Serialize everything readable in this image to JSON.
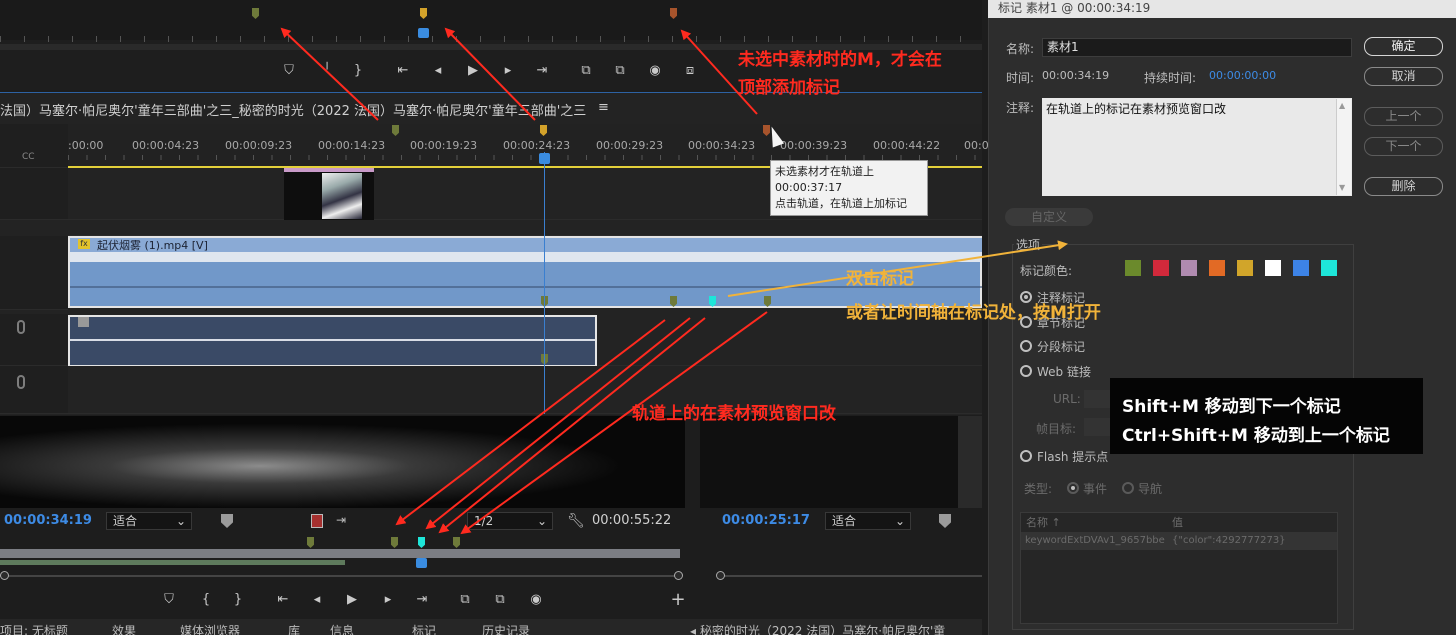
{
  "top_monitor": {
    "transport": [
      "⛉",
      "╵",
      "}",
      "⇤",
      "◂",
      "▶",
      "▸",
      "⇥",
      "⧉",
      "⧉",
      "◉",
      "⧈"
    ]
  },
  "timeline": {
    "sequence_title": "法国）马塞尔·帕尼奥尔'童年三部曲'之三_秘密的时光（2022 法国）马塞尔·帕尼奥尔'童年三部曲'之三",
    "menu_glyph": "≡",
    "cc_label": "CC",
    "ruler_labels": [
      ":00:00",
      "00:00:04:23",
      "00:00:09:23",
      "00:00:14:23",
      "00:00:19:23",
      "00:00:24:23",
      "00:00:29:23",
      "00:00:34:23",
      "00:00:39:23",
      "00:00:44:22",
      "00:0"
    ],
    "clip_v1_name": "起伏烟雾 (1).mp4 [V]",
    "fx": "fx",
    "tooltip": {
      "line1": "未选素材才在轨道上",
      "line2": "00:00:37:17",
      "line3": "点击轨道，在轨道上加标记"
    }
  },
  "source_monitor": {
    "timecode": "00:00:34:19",
    "fit": "适合",
    "resolution": "1/2",
    "duration": "00:00:55:22",
    "transport": [
      "⛉",
      "{",
      "}",
      "⇤",
      "◂",
      "▶",
      "▸",
      "⇥",
      "⧉",
      "⧉",
      "◉"
    ],
    "add": "+"
  },
  "program_monitor": {
    "timecode": "00:00:25:17",
    "fit": "适合"
  },
  "bottom_tabs": [
    "项目: 无标题",
    "效果",
    "媒体浏览器",
    "库",
    "信息",
    "标记",
    "历史记录"
  ],
  "bottom_extra": "◂ 秘密的时光（2022 法国）马塞尔·帕尼奥尔'童",
  "dialog": {
    "title": "标记 素材1 @ 00:00:34:19",
    "name_label": "名称:",
    "name_value": "素材1",
    "time_label": "时间:",
    "time_value": "00:00:34:19",
    "duration_label": "持续时间:",
    "duration_value": "00:00:00:00",
    "notes_label": "注释:",
    "notes_value": "在轨道上的标记在素材预览窗口改",
    "buttons": {
      "ok": "确定",
      "cancel": "取消",
      "prev": "上一个",
      "next": "下一个",
      "delete": "删除"
    },
    "custom": "自定义",
    "options": "选项",
    "marker_color_label": "标记颜色:",
    "colors": [
      "#6b8a2c",
      "#d2293b",
      "#b08bb0",
      "#e26a25",
      "#d1a52a",
      "#ffffff",
      "#3d83e6",
      "#1ee6d9"
    ],
    "marker_types": [
      "注释标记",
      "章节标记",
      "分段标记",
      "Web 链接",
      "Flash 提示点"
    ],
    "url_label": "URL:",
    "frame_target_label": "帧目标:",
    "type_label": "类型:",
    "type_options": [
      "事件",
      "导航"
    ],
    "table_header": [
      "名称 ↑",
      "值"
    ],
    "table_row": [
      "keywordExtDVAv1_9657bbe",
      "{\"color\":4292777273}"
    ]
  },
  "annotations": {
    "red_top_line1": "未选中素材时的M，才会在",
    "red_top_line2": "顶部添加标记",
    "red_mid": "轨道上的在素材预览窗口改",
    "orange_line1": "双击标记",
    "orange_line2": "或者让时间轴在标记处，按M打开",
    "shortcut_line1": "Shift+M 移动到下一个标记",
    "shortcut_line2": "Ctrl+Shift+M 移动到上一个标记"
  },
  "colors": {
    "accent_blue": "#3d8be5",
    "annotation_red": "#ff2a1f",
    "annotation_orange": "#f1b33a",
    "clip_blue": "#7198c9"
  }
}
